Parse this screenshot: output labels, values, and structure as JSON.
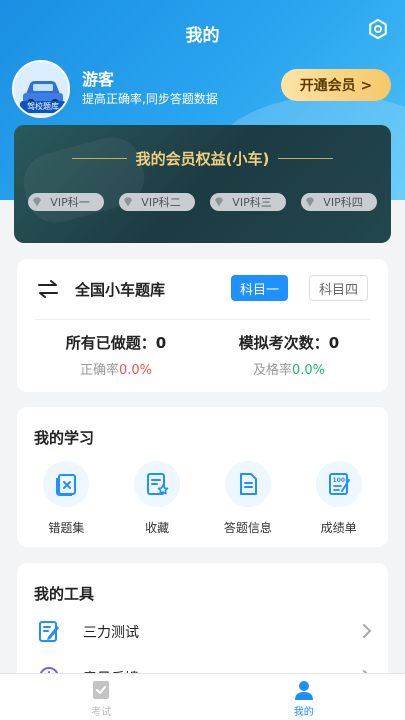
{
  "header": {
    "title": "我的"
  },
  "profile": {
    "name": "游客",
    "subtitle": "提高正确率,同步答题数据",
    "avatar_badge": "驾校题库",
    "vip_button": "开通会员 >"
  },
  "benefits": {
    "title": "我的会员权益(小车)",
    "tags": [
      "VIP科一",
      "VIP科二",
      "VIP科三",
      "VIP科四"
    ]
  },
  "question_bank": {
    "title": "全国小车题库",
    "subjects": [
      "科目一",
      "科目四"
    ],
    "active_subject": "科目一",
    "done": {
      "label": "所有已做题：",
      "value": "0",
      "rate_label": "正确率",
      "rate_value": "0.0%"
    },
    "mock": {
      "label": "模拟考次数：",
      "value": "0",
      "rate_label": "及格率",
      "rate_value": "0.0%"
    }
  },
  "study": {
    "title": "我的学习",
    "items": [
      {
        "label": "错题集",
        "icon": "wrong-questions-icon"
      },
      {
        "label": "收藏",
        "icon": "favorites-icon"
      },
      {
        "label": "答题信息",
        "icon": "answer-info-icon"
      },
      {
        "label": "成绩单",
        "icon": "transcript-icon"
      }
    ]
  },
  "tools": {
    "title": "我的工具",
    "items": [
      {
        "label": "三力测试",
        "icon": "three-ability-test-icon"
      },
      {
        "label": "意见反馈",
        "icon": "feedback-icon"
      }
    ]
  },
  "tabbar": {
    "tabs": [
      {
        "label": "考试",
        "active": false
      },
      {
        "label": "我的",
        "active": true
      }
    ]
  },
  "colors": {
    "primary": "#1e90ff",
    "header_gradient_start": "#1a8fe3",
    "gold": "#f0cf7e",
    "red": "#ff4d4f",
    "green": "#19be6b",
    "tab_active": "#1e90ff",
    "tab_inactive": "#bbbbbb"
  }
}
